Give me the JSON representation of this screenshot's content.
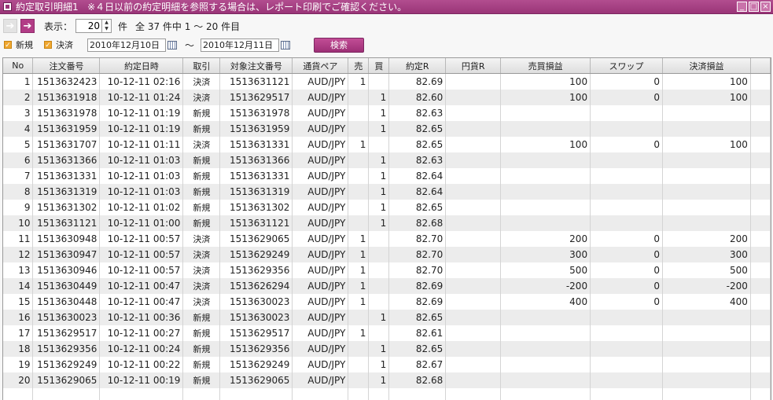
{
  "window": {
    "title": "約定取引明細1",
    "notice": "※４日以前の約定明細を参照する場合は、レポート印刷でご確認ください。"
  },
  "toolbar": {
    "display_label": "表示：",
    "page_size": "20",
    "unit_label": "件",
    "total_text": "全 37 件中 1 ～ 20 件目"
  },
  "filters": {
    "new_label": "新規",
    "settle_label": "決済",
    "date_from": "2010年12月10日",
    "tilde": "～",
    "date_to": "2010年12月11日",
    "search_label": "検索"
  },
  "table": {
    "headers": [
      "No",
      "注文番号",
      "約定日時",
      "取引",
      "対象注文番号",
      "通貨ペア",
      "売",
      "買",
      "約定R",
      "円貨R",
      "売買損益",
      "スワップ",
      "決済損益"
    ],
    "rows": [
      [
        "1",
        "1513632423",
        "10-12-11 02:16",
        "決済",
        "1513631121",
        "AUD/JPY",
        "1",
        "",
        "82.69",
        "",
        "100",
        "0",
        "100"
      ],
      [
        "2",
        "1513631918",
        "10-12-11 01:24",
        "決済",
        "1513629517",
        "AUD/JPY",
        "",
        "1",
        "82.60",
        "",
        "100",
        "0",
        "100"
      ],
      [
        "3",
        "1513631978",
        "10-12-11 01:19",
        "新規",
        "1513631978",
        "AUD/JPY",
        "",
        "1",
        "82.63",
        "",
        "",
        "",
        ""
      ],
      [
        "4",
        "1513631959",
        "10-12-11 01:19",
        "新規",
        "1513631959",
        "AUD/JPY",
        "",
        "1",
        "82.65",
        "",
        "",
        "",
        ""
      ],
      [
        "5",
        "1513631707",
        "10-12-11 01:11",
        "決済",
        "1513631331",
        "AUD/JPY",
        "1",
        "",
        "82.65",
        "",
        "100",
        "0",
        "100"
      ],
      [
        "6",
        "1513631366",
        "10-12-11 01:03",
        "新規",
        "1513631366",
        "AUD/JPY",
        "",
        "1",
        "82.63",
        "",
        "",
        "",
        ""
      ],
      [
        "7",
        "1513631331",
        "10-12-11 01:03",
        "新規",
        "1513631331",
        "AUD/JPY",
        "",
        "1",
        "82.64",
        "",
        "",
        "",
        ""
      ],
      [
        "8",
        "1513631319",
        "10-12-11 01:03",
        "新規",
        "1513631319",
        "AUD/JPY",
        "",
        "1",
        "82.64",
        "",
        "",
        "",
        ""
      ],
      [
        "9",
        "1513631302",
        "10-12-11 01:02",
        "新規",
        "1513631302",
        "AUD/JPY",
        "",
        "1",
        "82.65",
        "",
        "",
        "",
        ""
      ],
      [
        "10",
        "1513631121",
        "10-12-11 01:00",
        "新規",
        "1513631121",
        "AUD/JPY",
        "",
        "1",
        "82.68",
        "",
        "",
        "",
        ""
      ],
      [
        "11",
        "1513630948",
        "10-12-11 00:57",
        "決済",
        "1513629065",
        "AUD/JPY",
        "1",
        "",
        "82.70",
        "",
        "200",
        "0",
        "200"
      ],
      [
        "12",
        "1513630947",
        "10-12-11 00:57",
        "決済",
        "1513629249",
        "AUD/JPY",
        "1",
        "",
        "82.70",
        "",
        "300",
        "0",
        "300"
      ],
      [
        "13",
        "1513630946",
        "10-12-11 00:57",
        "決済",
        "1513629356",
        "AUD/JPY",
        "1",
        "",
        "82.70",
        "",
        "500",
        "0",
        "500"
      ],
      [
        "14",
        "1513630449",
        "10-12-11 00:47",
        "決済",
        "1513626294",
        "AUD/JPY",
        "1",
        "",
        "82.69",
        "",
        "-200",
        "0",
        "-200"
      ],
      [
        "15",
        "1513630448",
        "10-12-11 00:47",
        "決済",
        "1513630023",
        "AUD/JPY",
        "1",
        "",
        "82.69",
        "",
        "400",
        "0",
        "400"
      ],
      [
        "16",
        "1513630023",
        "10-12-11 00:36",
        "新規",
        "1513630023",
        "AUD/JPY",
        "",
        "1",
        "82.65",
        "",
        "",
        "",
        ""
      ],
      [
        "17",
        "1513629517",
        "10-12-11 00:27",
        "新規",
        "1513629517",
        "AUD/JPY",
        "1",
        "",
        "82.61",
        "",
        "",
        "",
        ""
      ],
      [
        "18",
        "1513629356",
        "10-12-11 00:24",
        "新規",
        "1513629356",
        "AUD/JPY",
        "",
        "1",
        "82.65",
        "",
        "",
        "",
        ""
      ],
      [
        "19",
        "1513629249",
        "10-12-11 00:22",
        "新規",
        "1513629249",
        "AUD/JPY",
        "",
        "1",
        "82.67",
        "",
        "",
        "",
        ""
      ],
      [
        "20",
        "1513629065",
        "10-12-11 00:19",
        "新規",
        "1513629065",
        "AUD/JPY",
        "",
        "1",
        "82.68",
        "",
        "",
        "",
        ""
      ]
    ]
  },
  "colors": {
    "accent": "#9a3578",
    "checkbox": "#f0a830"
  }
}
